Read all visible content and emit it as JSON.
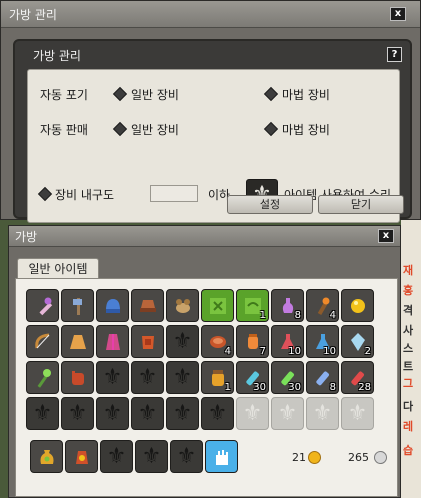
{
  "management": {
    "window_title": "가방 관리",
    "close_label": "x",
    "inner_title": "가방 관리",
    "help_label": "?",
    "auto_discard_label": "자동 포기",
    "auto_sell_label": "자동 판매",
    "normal_equipment": "일반 장비",
    "magic_equipment": "마법 장비",
    "durability_label": "장비 내구도",
    "durability_value": "",
    "below_label": "이하",
    "repair_label": "아이템 사용하여 수리",
    "settings_button": "설정",
    "close_button": "닫기"
  },
  "bag": {
    "window_title": "가방",
    "close_label": "x",
    "tab_label": "일반 아이템",
    "gold_amount": "21",
    "silver_amount": "265",
    "row1_qty": [
      "",
      "",
      "",
      "",
      "",
      "",
      "1",
      "8",
      "4",
      ""
    ],
    "row2_qty": [
      "",
      "",
      "",
      "",
      "",
      "4",
      "7",
      "10",
      "10",
      "2"
    ],
    "row3_qty": [
      "",
      "",
      "",
      "",
      "",
      "1",
      "30",
      "30",
      "8",
      "28"
    ],
    "colors": {
      "panel": "#6e6b66",
      "grid_bg": "#f1efe9",
      "empty_slot": "#3a3936",
      "locked_slot": "#c8c7c2"
    }
  },
  "background_text": [
    "재",
    "홍",
    "격",
    "사",
    "스",
    "트",
    "그",
    "다",
    "레",
    "습"
  ],
  "icons": {
    "empty_slot": "fleur-de-lis-icon",
    "locked_slot": "fleur-de-lis-icon",
    "gold_coin": "gold-coin-icon",
    "silver_coin": "silver-coin-icon"
  }
}
